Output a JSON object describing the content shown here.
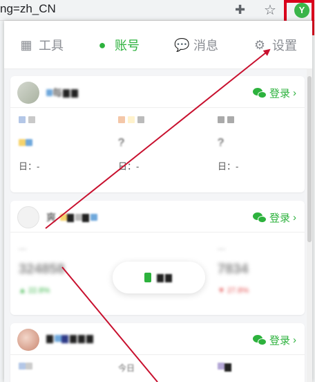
{
  "browser": {
    "url_fragment": "ng=zh_CN",
    "extension_badge": "Y"
  },
  "tabs": [
    {
      "label": "工具",
      "icon": "grid-icon"
    },
    {
      "label": "账号",
      "icon": "user-icon",
      "active": true
    },
    {
      "label": "消息",
      "icon": "chat-bubble-icon"
    },
    {
      "label": "设置",
      "icon": "gear-icon"
    }
  ],
  "accounts": [
    {
      "name_visible": "每",
      "login_label": "登录",
      "stats": [
        {
          "label": "",
          "value": ""
        },
        {
          "label": "",
          "value": ""
        },
        {
          "label": "",
          "value": ""
        }
      ],
      "day_labels": [
        "日：-",
        "日：-",
        "日：-"
      ]
    },
    {
      "name_visible": "爽",
      "login_label": "登录",
      "stats": [
        {
          "value_blurred": "324858",
          "change_blurred": "▲ 22.8%"
        },
        {
          "value_blurred": "",
          "change_blurred": ""
        },
        {
          "value_blurred": "7834",
          "change_blurred": "▼ 27.8%"
        }
      ]
    },
    {
      "name_visible": "",
      "login_label": "登录",
      "row_labels": [
        "",
        "今日",
        ""
      ]
    }
  ],
  "colors": {
    "accent": "#2db23d",
    "highlight": "#d9001b",
    "arrow": "#c8102e"
  }
}
